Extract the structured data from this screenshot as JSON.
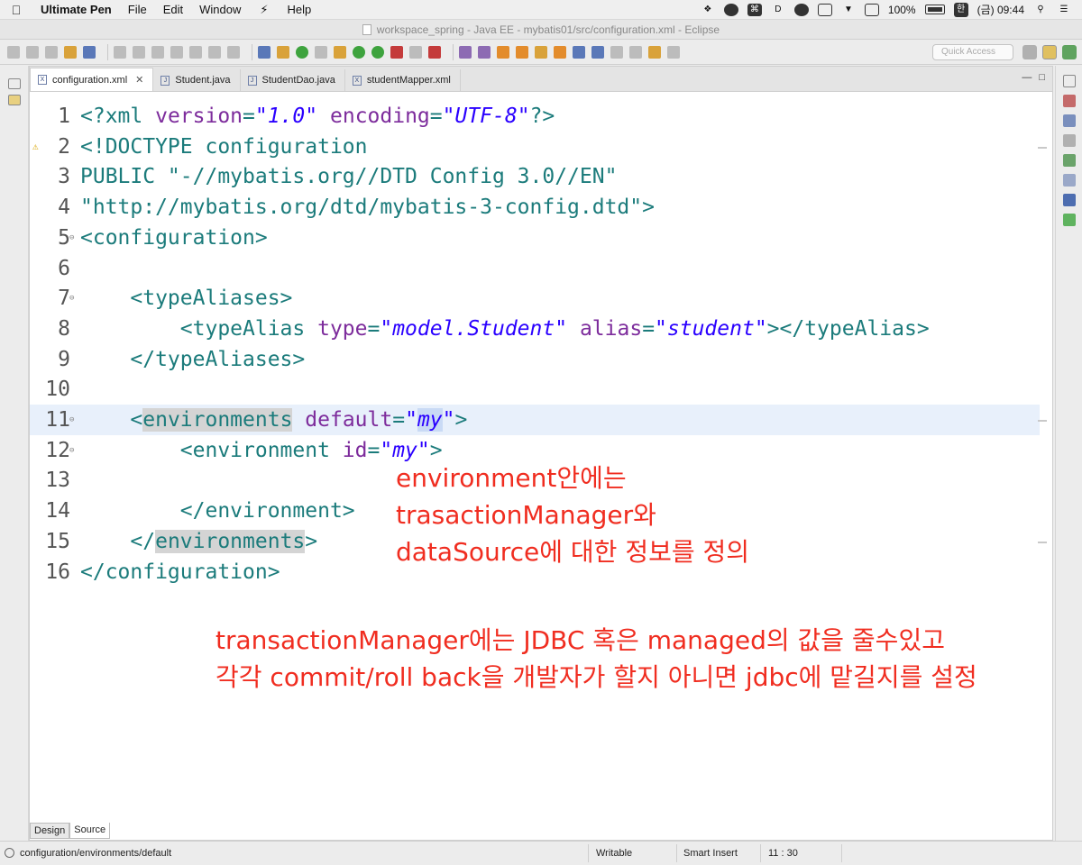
{
  "menubar": {
    "app_name": "Ultimate Pen",
    "items": [
      "File",
      "Edit",
      "Window",
      "Help"
    ],
    "battery": "100%",
    "input_method": "한",
    "clock": "(금) 09:44"
  },
  "window": {
    "title": "workspace_spring - Java EE - mybatis01/src/configuration.xml - Eclipse"
  },
  "toolbar": {
    "quick_access_placeholder": "Quick Access"
  },
  "editor": {
    "tabs": [
      {
        "label": "configuration.xml",
        "icon": "xml-file-icon",
        "active": true
      },
      {
        "label": "Student.java",
        "icon": "java-file-icon",
        "active": false
      },
      {
        "label": "StudentDao.java",
        "icon": "java-file-icon",
        "active": false
      },
      {
        "label": "studentMapper.xml",
        "icon": "xml-file-icon",
        "active": false
      }
    ],
    "lines": [
      {
        "n": "1",
        "t": [
          [
            "<?xml ",
            "tag"
          ],
          [
            "version",
            "attr"
          ],
          [
            "=",
            "punct"
          ],
          [
            "\"1.0\"",
            "val"
          ],
          [
            " ",
            ""
          ],
          [
            "encoding",
            "attr"
          ],
          [
            "=",
            "punct"
          ],
          [
            "\"UTF-8\"",
            "val"
          ],
          [
            "?>",
            "tag"
          ]
        ]
      },
      {
        "n": "2",
        "t": [
          [
            "<!DOCTYPE configuration",
            "doctype"
          ]
        ]
      },
      {
        "n": "3",
        "t": [
          [
            "PUBLIC \"-//mybatis.org//DTD Config 3.0//EN\"",
            "doctype"
          ]
        ]
      },
      {
        "n": "4",
        "t": [
          [
            "\"http://mybatis.org/dtd/mybatis-3-config.dtd\">",
            "doctype"
          ]
        ]
      },
      {
        "n": "5",
        "t": [
          [
            "<configuration>",
            "tag"
          ]
        ]
      },
      {
        "n": "6",
        "t": []
      },
      {
        "n": "7",
        "t": [
          [
            "    ",
            ""
          ],
          [
            "<typeAliases>",
            "tag"
          ]
        ]
      },
      {
        "n": "8",
        "t": [
          [
            "        ",
            ""
          ],
          [
            "<typeAlias ",
            "tag"
          ],
          [
            "type",
            "attr"
          ],
          [
            "=",
            "punct"
          ],
          [
            "\"model.Student\"",
            "val"
          ],
          [
            " ",
            ""
          ],
          [
            "alias",
            "attr"
          ],
          [
            "=",
            "punct"
          ],
          [
            "\"student\"",
            "val"
          ],
          [
            "></typeAlias>",
            "tag"
          ]
        ]
      },
      {
        "n": "9",
        "t": [
          [
            "    ",
            ""
          ],
          [
            "</typeAliases>",
            "tag"
          ]
        ]
      },
      {
        "n": "10",
        "t": []
      },
      {
        "n": "11",
        "t": [
          [
            "    ",
            ""
          ],
          [
            "<",
            "tag"
          ],
          [
            "environments",
            "tag hl-word"
          ],
          [
            " ",
            ""
          ],
          [
            "default",
            "attr"
          ],
          [
            "=",
            "punct"
          ],
          [
            "\"",
            "val"
          ],
          [
            "my",
            "val hl-val"
          ],
          [
            "\"",
            "val"
          ],
          [
            ">",
            "tag"
          ]
        ]
      },
      {
        "n": "12",
        "t": [
          [
            "        ",
            ""
          ],
          [
            "<environment ",
            "tag"
          ],
          [
            "id",
            "attr"
          ],
          [
            "=",
            "punct"
          ],
          [
            "\"my\"",
            "val"
          ],
          [
            ">",
            "tag"
          ]
        ]
      },
      {
        "n": "13",
        "t": []
      },
      {
        "n": "14",
        "t": [
          [
            "        ",
            ""
          ],
          [
            "</environment>",
            "tag"
          ]
        ]
      },
      {
        "n": "15",
        "t": [
          [
            "    ",
            ""
          ],
          [
            "</",
            "tag"
          ],
          [
            "environments",
            "tag hl-word"
          ],
          [
            ">",
            "tag"
          ]
        ]
      },
      {
        "n": "16",
        "t": [
          [
            "</configuration>",
            "tag"
          ]
        ]
      }
    ],
    "current_line": "11",
    "warning_line": "2",
    "fold_lines": [
      "5",
      "7",
      "11",
      "12"
    ],
    "annotations": {
      "note1": [
        "environment안에는",
        "trasactionManager와",
        "dataSource에 대한 정보를 정의"
      ],
      "note2": [
        "transactionManager에는 JDBC 혹은 managed의 값을 줄수있고",
        "각각 commit/roll back을 개발자가 할지 아니면 jdbc에 맡길지를 설정"
      ]
    },
    "bottom_tabs": {
      "design": "Design",
      "source": "Source"
    }
  },
  "status": {
    "path": "configuration/environments/default",
    "mode": "Writable",
    "insert": "Smart Insert",
    "position": "11 : 30"
  },
  "colors": {
    "annotation": "#f02d20",
    "tag": "#1b7b7b",
    "attribute": "#7d2c9c",
    "value": "#2a00ff",
    "current_line": "#e8f0fb"
  }
}
